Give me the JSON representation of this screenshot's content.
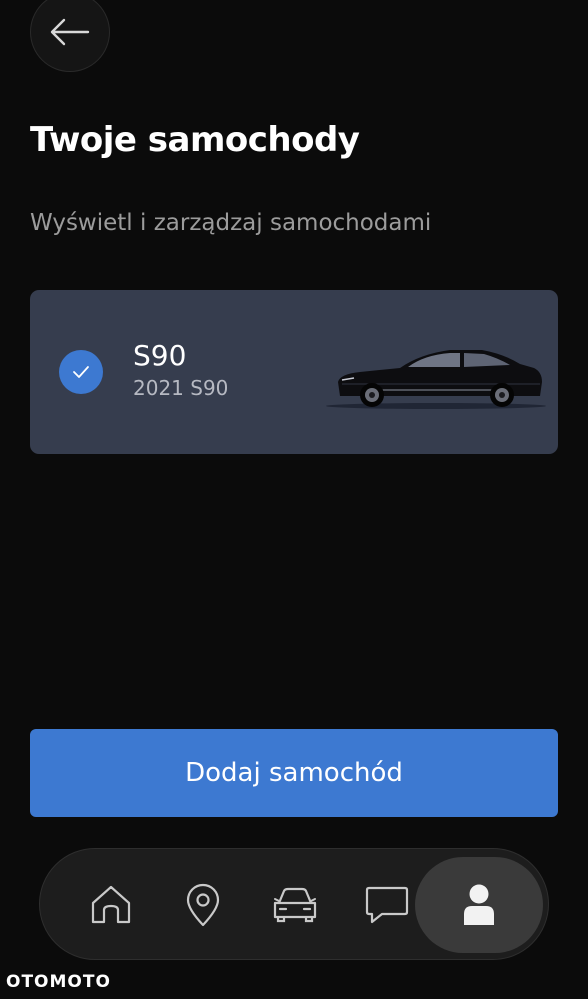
{
  "header": {
    "back_icon": "arrow-left-icon"
  },
  "page": {
    "title": "Twoje samochody",
    "subtitle": "Wyświetl i zarządzaj samochodami"
  },
  "cars": [
    {
      "name": "S90",
      "description": "2021 S90",
      "selected": true,
      "check_icon": "checkmark-icon",
      "image": "black-sedan-image"
    }
  ],
  "actions": {
    "add_car_label": "Dodaj samochód"
  },
  "nav": {
    "items": [
      {
        "icon": "home-icon",
        "active": false
      },
      {
        "icon": "location-pin-icon",
        "active": false
      },
      {
        "icon": "car-icon",
        "active": false
      },
      {
        "icon": "chat-bubble-icon",
        "active": false
      },
      {
        "icon": "profile-icon",
        "active": true
      }
    ]
  },
  "watermark": {
    "text": "OTOMOTO"
  },
  "colors": {
    "background": "#0b0b0b",
    "card": "#363d4e",
    "accent": "#3d79d1",
    "subtitle": "#9c9c9c",
    "nav_bar": "#1d1d1d",
    "nav_active": "#3a3a3a"
  }
}
